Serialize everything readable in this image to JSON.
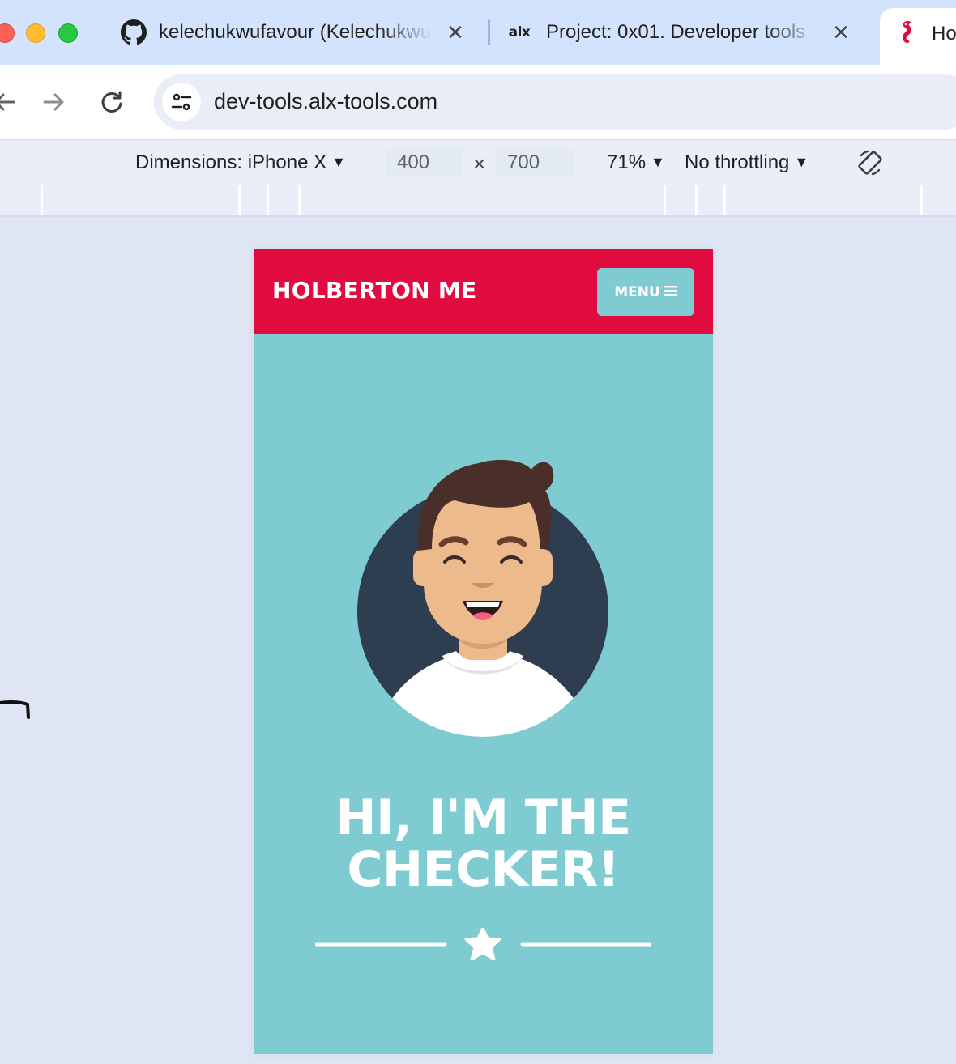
{
  "browser": {
    "tabs": [
      {
        "title": "kelechukwufavour (Kelechukwu",
        "icon": "github-icon",
        "closable": true
      },
      {
        "title": "Project: 0x01. Developer tools",
        "icon": "alx-logo",
        "favicon_text": "alx",
        "closable": true
      },
      {
        "title": "Ho",
        "icon": "seahorse-icon",
        "active": true
      }
    ],
    "url": "dev-tools.alx-tools.com"
  },
  "device_toolbar": {
    "dimensions_label": "Dimensions: iPhone X",
    "width": "400",
    "times": "×",
    "height": "700",
    "zoom": "71%",
    "throttling": "No throttling"
  },
  "site": {
    "brand": "HOLBERTON ME",
    "menu_label": "MENU",
    "headline_line1": "HI, I'M THE",
    "headline_line2": "CHECKER!"
  },
  "colors": {
    "header_red": "#e20b3f",
    "teal": "#7ecbd1",
    "avatar_bg": "#2e3e50",
    "skin": "#ecba8b",
    "hair": "#4a2e2a"
  }
}
